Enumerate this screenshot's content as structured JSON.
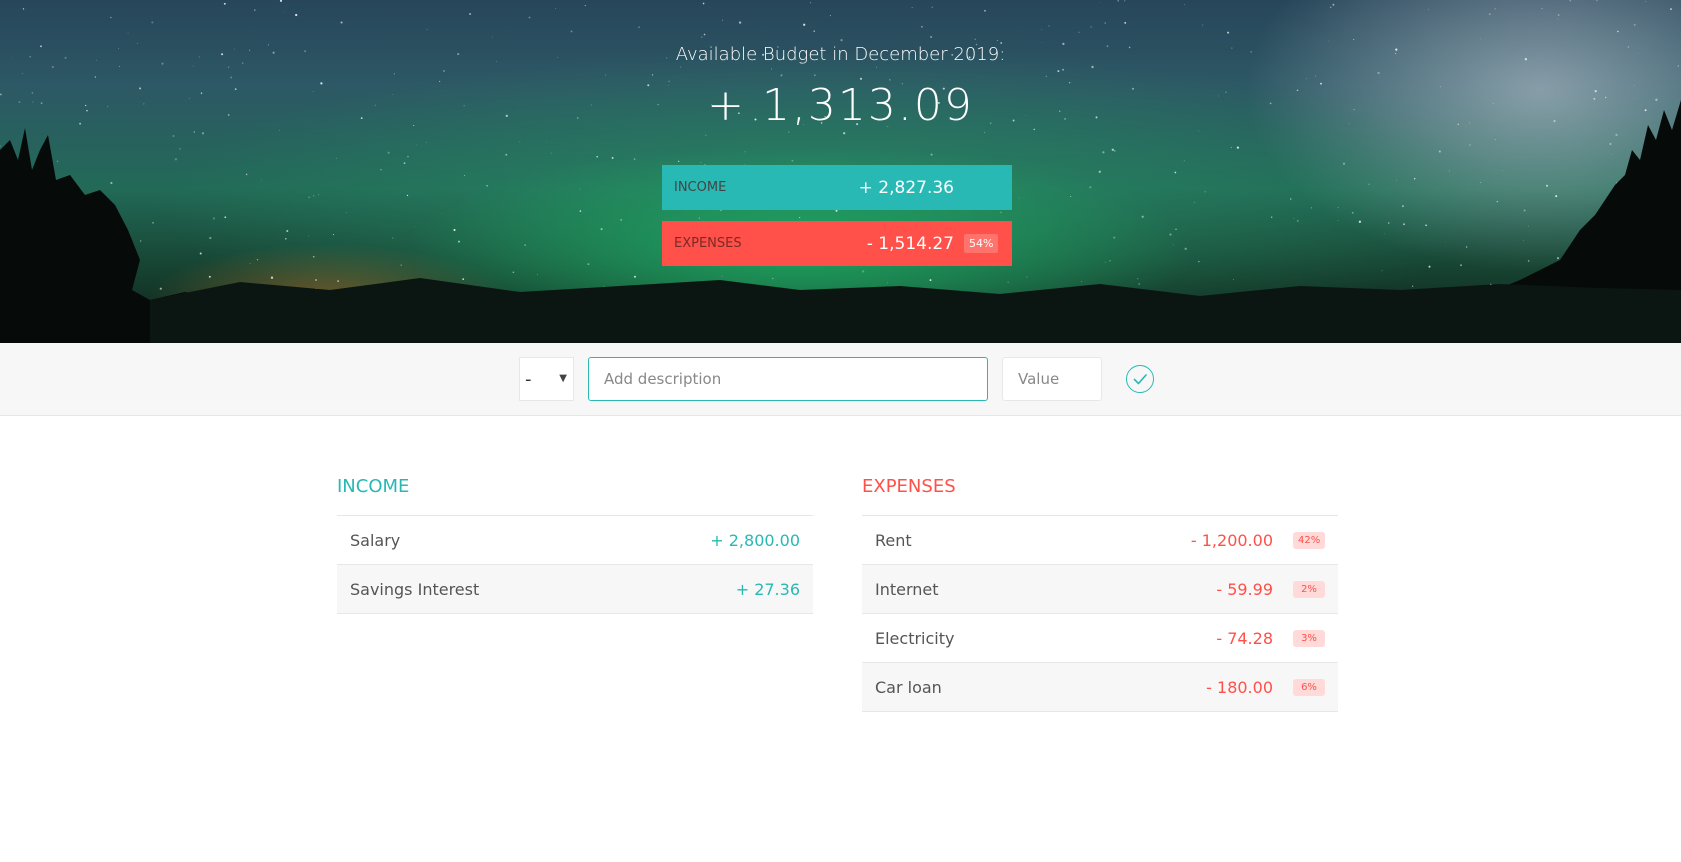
{
  "budget": {
    "title": "Available Budget in December 2019:",
    "value": "+ 1,313.09",
    "income_label": "Income",
    "income_value": "+ 2,827.36",
    "expenses_label": "Expenses",
    "expenses_value": "- 1,514.27",
    "expenses_percentage": "54%"
  },
  "add_form": {
    "type_value": "-",
    "description_placeholder": "Add description",
    "value_placeholder": "Value",
    "submit_icon": "checkmark-circle-icon"
  },
  "income": {
    "title": "Income",
    "items": [
      {
        "description": "Salary",
        "value": "+ 2,800.00"
      },
      {
        "description": "Savings Interest",
        "value": "+ 27.36"
      }
    ]
  },
  "expenses": {
    "title": "Expenses",
    "items": [
      {
        "description": "Rent",
        "value": "- 1,200.00",
        "percentage": "42%"
      },
      {
        "description": "Internet",
        "value": "- 59.99",
        "percentage": "2%"
      },
      {
        "description": "Electricity",
        "value": "- 74.28",
        "percentage": "3%"
      },
      {
        "description": "Car loan",
        "value": "- 180.00",
        "percentage": "6%"
      }
    ]
  },
  "colors": {
    "income_accent": "#28b9b5",
    "expenses_accent": "#ff5049"
  }
}
